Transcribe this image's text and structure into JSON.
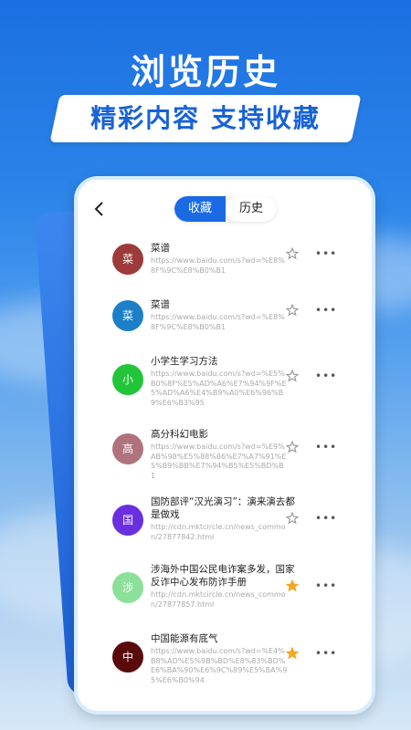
{
  "promo": {
    "headline": "浏览历史",
    "subtitle": "精彩内容 支持收藏"
  },
  "tabs": {
    "favorites_label": "收藏",
    "history_label": "历史",
    "active": "favorites"
  },
  "colors": {
    "accent": "#1a6ae3",
    "star_filled": "#f5a623",
    "star_empty": "#999999"
  },
  "items": [
    {
      "avatar_char": "菜",
      "avatar_color": "#9e3a3a",
      "title": "菜谱",
      "url": "https://www.baidu.com/s?wd=%E8%8F%9C%E8%B0%B1",
      "starred": false
    },
    {
      "avatar_char": "菜",
      "avatar_color": "#1c7fc8",
      "title": "菜谱",
      "url": "https://www.baidu.com/s?wd=%E8%8F%9C%E8%B0%B1",
      "starred": false
    },
    {
      "avatar_char": "小",
      "avatar_color": "#22c43a",
      "title": "小学生学习方法",
      "url": "https://www.baidu.com/s?wd=%E5%B0%8F%E5%AD%A6%E7%94%9F%E5%AD%A6%E4%B9%A0%E6%96%B9%E6%B3%95",
      "starred": false
    },
    {
      "avatar_char": "高",
      "avatar_color": "#b0737e",
      "title": "高分科幻电影",
      "url": "https://www.baidu.com/s?wd=%E9%AB%98%E5%88%86%E7%A7%91%E5%B9%BB%E7%94%B5%E5%BD%B1",
      "starred": false
    },
    {
      "avatar_char": "国",
      "avatar_color": "#6a2fe0",
      "title": "国防部评“汉光演习”：演来演去都是做戏",
      "url": "http://cdn.mktcircle.cn/news_common/27877842.html",
      "starred": false
    },
    {
      "avatar_char": "涉",
      "avatar_color": "#8be09a",
      "title": "涉海外中国公民电诈案多发，国家反诈中心发布防诈手册",
      "url": "http://cdn.mktcircle.cn/news_common/27877857.html",
      "starred": true
    },
    {
      "avatar_char": "中",
      "avatar_color": "#5a0a0a",
      "title": "中国能源有底气",
      "url": "https://www.baidu.com/s?wd=%E4%B8%AD%E5%9B%BD%E8%83%BD%E6%BA%90%E6%9C%89%E5%BA%95%E6%B0%94",
      "starred": true
    }
  ]
}
